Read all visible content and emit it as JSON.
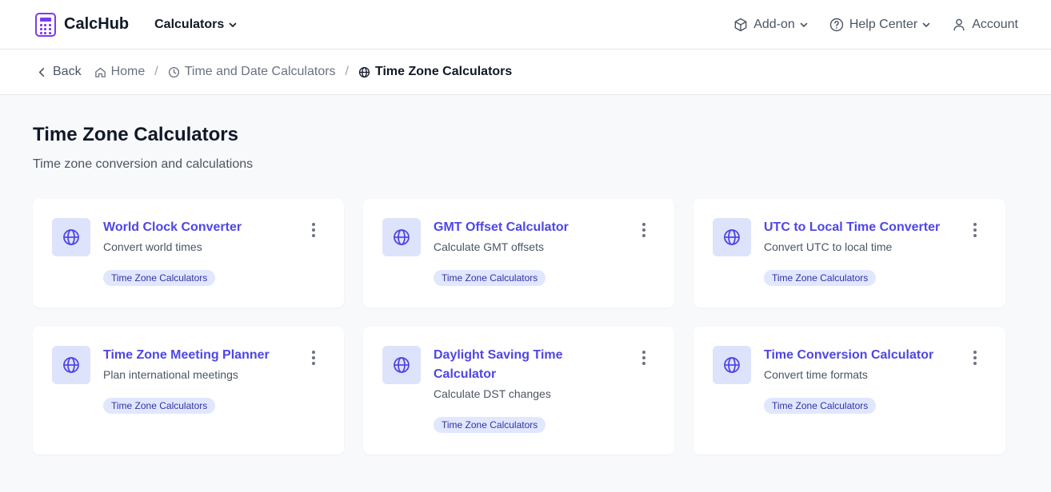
{
  "header": {
    "brand": "CalcHub",
    "calculators_label": "Calculators",
    "addon_label": "Add-on",
    "help_label": "Help Center",
    "account_label": "Account"
  },
  "breadcrumb": {
    "back": "Back",
    "home": "Home",
    "parent": "Time and Date Calculators",
    "current": "Time Zone Calculators"
  },
  "page": {
    "title": "Time Zone Calculators",
    "subtitle": "Time zone conversion and calculations"
  },
  "cards": [
    {
      "title": "World Clock Converter",
      "desc": "Convert world times",
      "tag": "Time Zone Calculators",
      "icon": "globe-icon"
    },
    {
      "title": "GMT Offset Calculator",
      "desc": "Calculate GMT offsets",
      "tag": "Time Zone Calculators",
      "icon": "globe-icon"
    },
    {
      "title": "UTC to Local Time Converter",
      "desc": "Convert UTC to local time",
      "tag": "Time Zone Calculators",
      "icon": "globe-icon"
    },
    {
      "title": "Time Zone Meeting Planner",
      "desc": "Plan international meetings",
      "tag": "Time Zone Calculators",
      "icon": "globe-icon"
    },
    {
      "title": "Daylight Saving Time Calculator",
      "desc": "Calculate DST changes",
      "tag": "Time Zone Calculators",
      "icon": "globe-icon"
    },
    {
      "title": "Time Conversion Calculator",
      "desc": "Convert time formats",
      "tag": "Time Zone Calculators",
      "icon": "globe-icon"
    }
  ],
  "colors": {
    "brand": "#7c3aed",
    "link": "#4f46e5",
    "tag_bg": "#e0e7ff",
    "icon_bg": "#dde3fb"
  }
}
